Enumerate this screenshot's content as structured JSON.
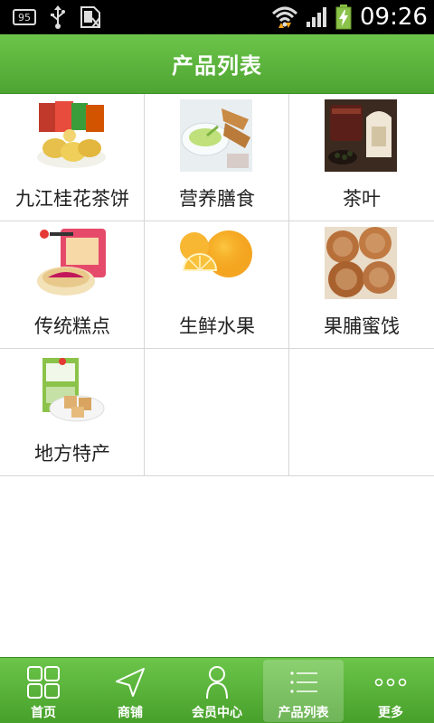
{
  "status_bar": {
    "battery_small_text": "95",
    "time": "09:26"
  },
  "header": {
    "title": "产品列表"
  },
  "products": [
    {
      "label": "九江桂花茶饼",
      "thumb_icon": "osmanthus-cake-photo"
    },
    {
      "label": "营养膳食",
      "thumb_icon": "nutrition-meal-photo"
    },
    {
      "label": "茶叶",
      "thumb_icon": "tea-leaves-photo"
    },
    {
      "label": "传统糕点",
      "thumb_icon": "traditional-pastry-photo"
    },
    {
      "label": "生鲜水果",
      "thumb_icon": "oranges-photo"
    },
    {
      "label": "果脯蜜饯",
      "thumb_icon": "candied-fruit-photo"
    },
    {
      "label": "地方特产",
      "thumb_icon": "local-specialty-photo"
    }
  ],
  "tab_bar": {
    "tabs": [
      {
        "label": "首页",
        "icon": "grid-icon",
        "active": false
      },
      {
        "label": "商铺",
        "icon": "navigation-arrow-icon",
        "active": false
      },
      {
        "label": "会员中心",
        "icon": "person-icon",
        "active": false
      },
      {
        "label": "产品列表",
        "icon": "list-icon",
        "active": true
      },
      {
        "label": "更多",
        "icon": "more-dots-icon",
        "active": false
      }
    ]
  },
  "colors": {
    "header_green": "#5db63c",
    "tab_green": "#55ad36",
    "divider": "#d6d6d6"
  }
}
